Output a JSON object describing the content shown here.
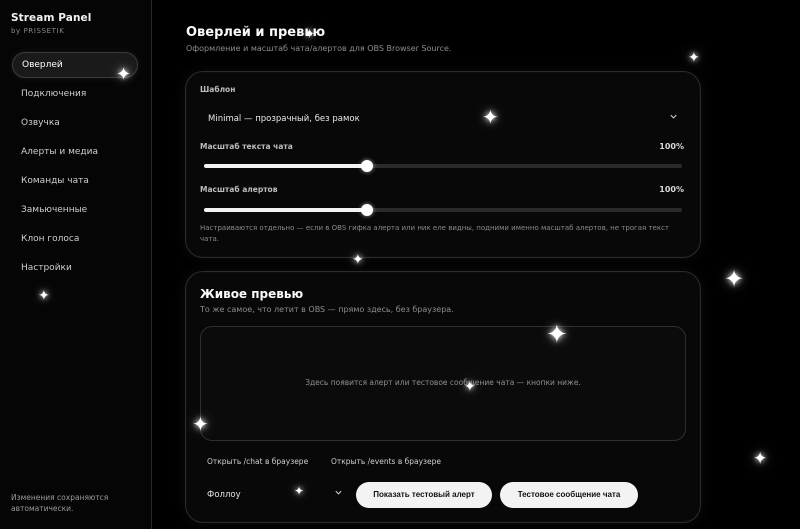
{
  "brand": {
    "title": "Stream Panel",
    "subtitle": "by PRISSETIK"
  },
  "sidebar": {
    "items": [
      {
        "label": "Оверлей",
        "active": true
      },
      {
        "label": "Подключения"
      },
      {
        "label": "Озвучка"
      },
      {
        "label": "Алерты и медиа"
      },
      {
        "label": "Команды чата"
      },
      {
        "label": "Замьюченные"
      },
      {
        "label": "Клон голоса"
      },
      {
        "label": "Настройки"
      }
    ],
    "footer": "Изменения сохраняются автоматически."
  },
  "header": {
    "title": "Оверлей и превью",
    "subtitle": "Оформление и масштаб чата/алертов для OBS Browser Source."
  },
  "template_card": {
    "template_label": "Шаблон",
    "template_value": "Minimal — прозрачный, без рамок",
    "chat_scale_label": "Масштаб текста чата",
    "chat_scale_value": "100%",
    "chat_scale_fraction": 0.34,
    "alert_scale_label": "Масштаб алертов",
    "alert_scale_value": "100%",
    "alert_scale_fraction": 0.34,
    "hint": "Настраиваются отдельно — если в OBS гифка алерта или ник еле видны, подними именно масштаб алертов, не трогая текст чата."
  },
  "preview_card": {
    "title": "Живое превью",
    "subtitle": "То же самое, что летит в OBS — прямо здесь, без браузера.",
    "placeholder": "Здесь появится алерт или тестовое сообщение чата — кнопки ниже.",
    "link_chat": "Открыть /chat в браузере",
    "link_events": "Открыть /events в браузере",
    "event_select": "Фоллоу",
    "btn_alert": "Показать тестовый алерт",
    "btn_message": "Тестовое сообщение чата"
  },
  "icons": {
    "dropdown": "chevron-down-icon",
    "sparkle": "sparkle-icon"
  }
}
